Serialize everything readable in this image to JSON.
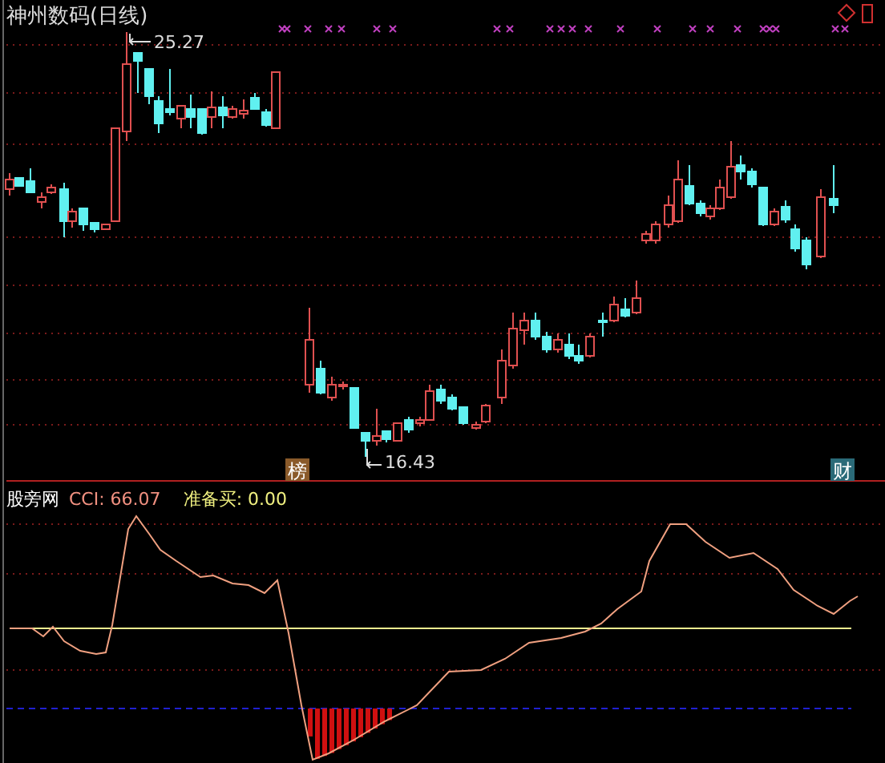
{
  "chart": {
    "title": "神州数码(日线)",
    "high_label": "25.27",
    "low_label": "16.43",
    "tags": [
      {
        "label": "榜",
        "kind": "rank"
      },
      {
        "label": "财",
        "kind": "finance"
      }
    ]
  },
  "indicator": {
    "name": "股旁网",
    "cci_label": "CCI: ",
    "cci_value": "66.07",
    "buy_label": "准备买: ",
    "buy_value": "0.00"
  }
}
